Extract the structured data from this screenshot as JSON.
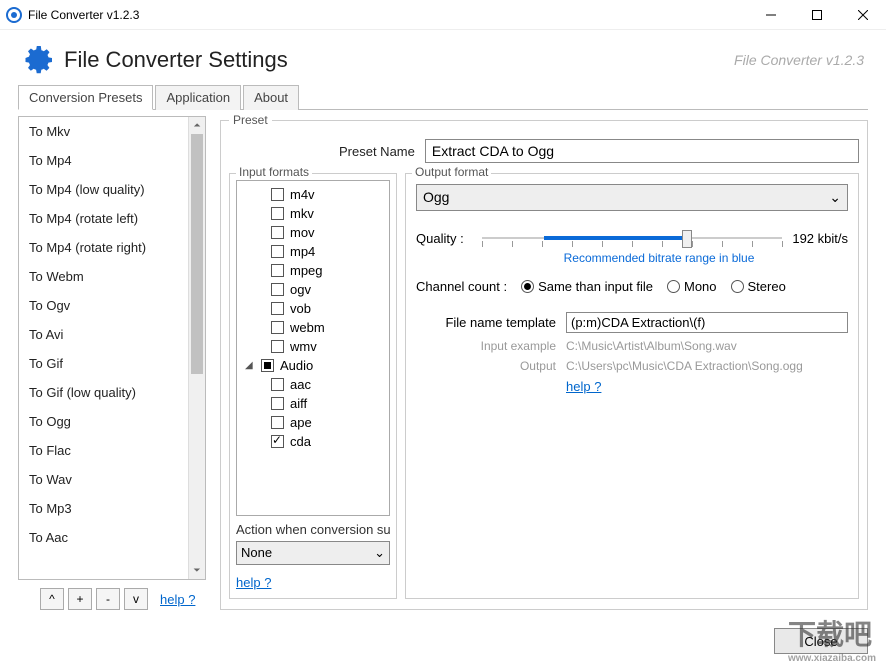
{
  "titlebar": {
    "title": "File Converter v1.2.3"
  },
  "header": {
    "title": "File Converter Settings",
    "version": "File Converter v1.2.3"
  },
  "tabs": [
    "Conversion Presets",
    "Application",
    "About"
  ],
  "presets": {
    "items": [
      "To Mkv",
      "To Mp4",
      "To Mp4 (low quality)",
      "To Mp4 (rotate left)",
      "To Mp4 (rotate right)",
      "To Webm",
      "To Ogv",
      "To Avi",
      "To Gif",
      "To Gif (low quality)",
      "To Ogg",
      "To Flac",
      "To Wav",
      "To Mp3",
      "To Aac"
    ],
    "btn_up": "^",
    "btn_add": "+",
    "btn_remove": "-",
    "btn_down": "v",
    "help": "help ?"
  },
  "preset": {
    "group": "Preset",
    "name_label": "Preset Name",
    "name_value": "Extract CDA to Ogg",
    "input_formats_label": "Input formats",
    "formats_video": [
      "m4v",
      "mkv",
      "mov",
      "mp4",
      "mpeg",
      "ogv",
      "vob",
      "webm",
      "wmv"
    ],
    "formats_audio_cat": "Audio",
    "formats_audio": [
      "aac",
      "aiff",
      "ape",
      "cda"
    ],
    "action_label": "Action when conversion su",
    "action_value": "None",
    "help": "help ?"
  },
  "output": {
    "group": "Output format",
    "format": "Ogg",
    "quality_label": "Quality :",
    "quality_value": "192 kbit/s",
    "reco": "Recommended bitrate range in blue",
    "channel_label": "Channel count :",
    "channel_options": [
      "Same than input file",
      "Mono",
      "Stereo"
    ],
    "template_label": "File name template",
    "template_value": "(p:m)CDA Extraction\\(f)",
    "input_example_label": "Input example",
    "input_example_value": "C:\\Music\\Artist\\Album\\Song.wav",
    "output_label": "Output",
    "output_value": "C:\\Users\\pc\\Music\\CDA Extraction\\Song.ogg",
    "help": "help ?"
  },
  "footer": {
    "close": "Close"
  }
}
